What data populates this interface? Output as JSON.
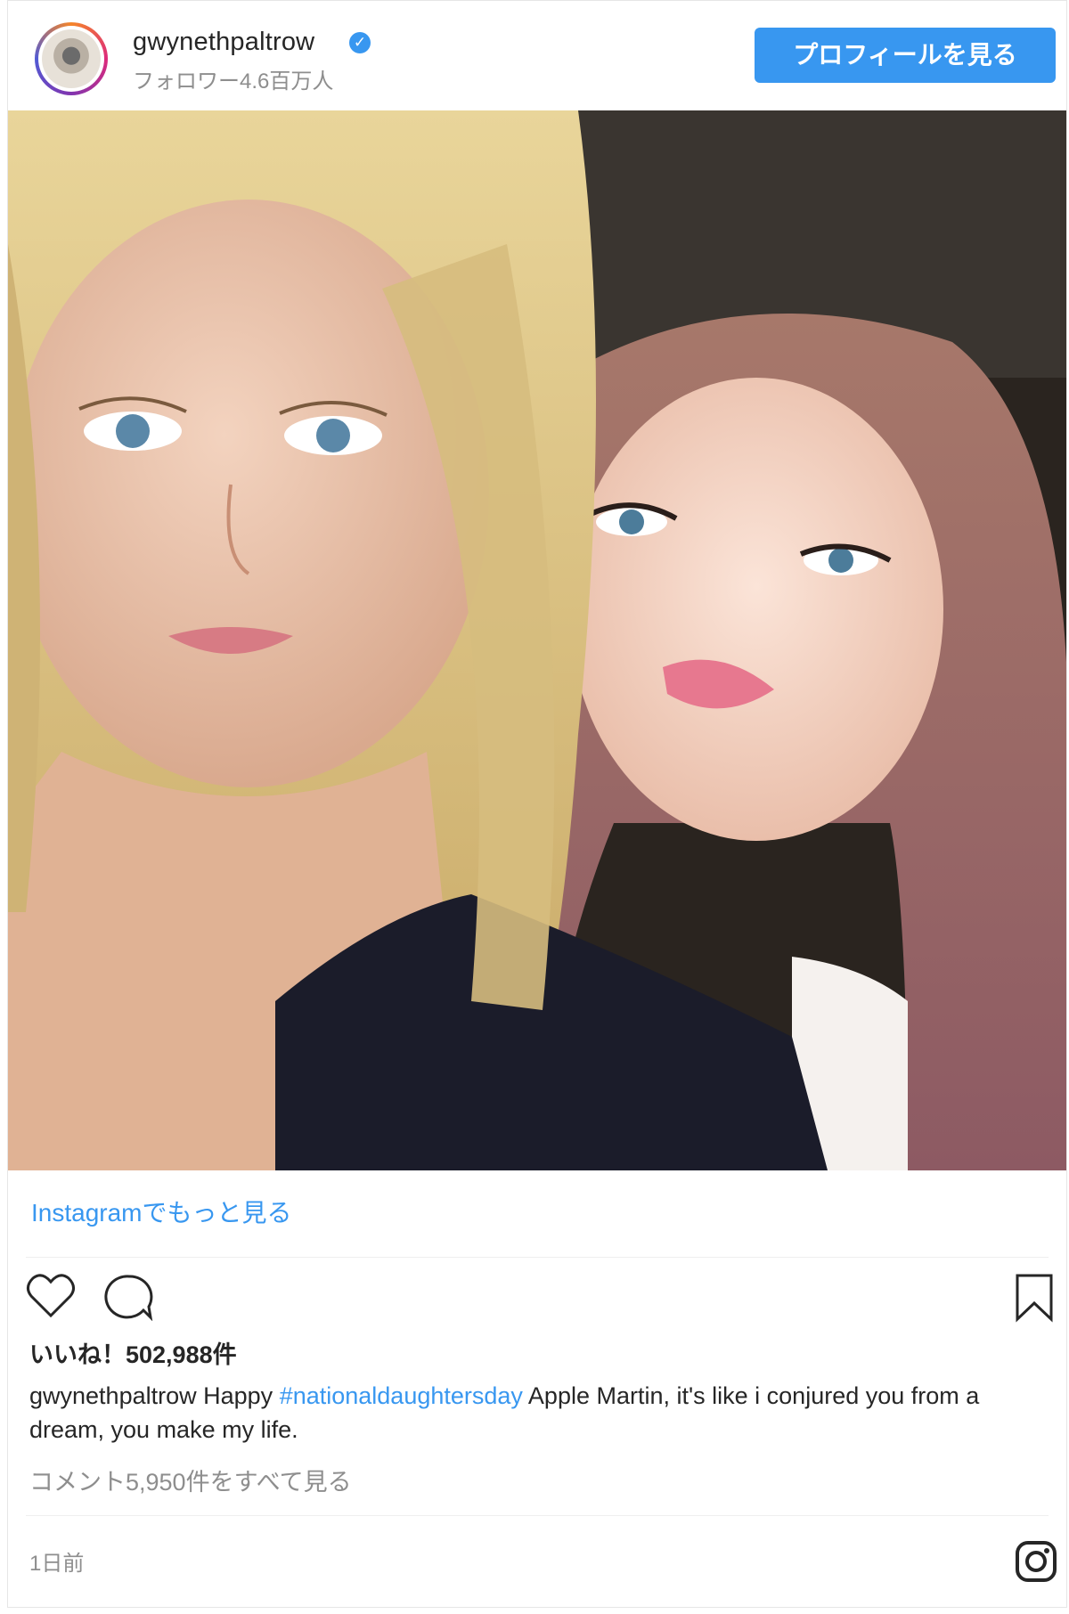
{
  "header": {
    "username": "gwynethpaltrow",
    "followers": "フォロワー4.6百万人",
    "profile_button": "プロフィールを見る"
  },
  "more_link": "Instagramでもっと見る",
  "actions": {
    "icons": [
      "heart-icon",
      "comment-icon",
      "bookmark-icon"
    ]
  },
  "likes": "いいね！502,988件",
  "caption": {
    "username": "gwynethpaltrow",
    "text_before": "Happy",
    "hashtag": "#nationaldaughtersday",
    "text_after": "Apple Martin, it's like i conjured you from a dream, you make my life."
  },
  "comments_link": "コメント5,950件をすべて見る",
  "timestamp": "1日前",
  "colors": {
    "link": "#3897f0",
    "text": "#262626",
    "muted": "#8e8e8e"
  }
}
